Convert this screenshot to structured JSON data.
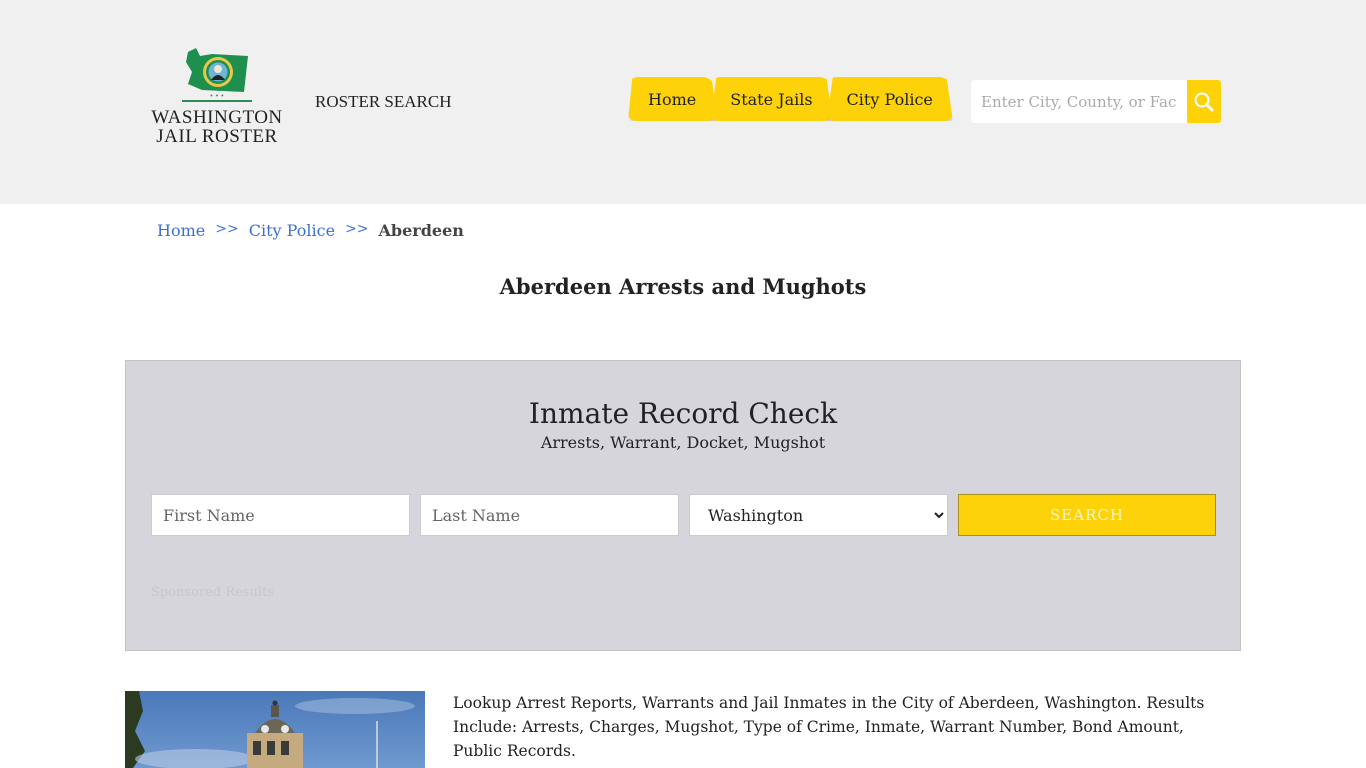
{
  "header": {
    "logo": {
      "line1": "WASHINGTON",
      "line2": "JAIL ROSTER"
    },
    "roster_search": "ROSTER SEARCH",
    "nav": [
      {
        "label": "Home"
      },
      {
        "label": "State Jails"
      },
      {
        "label": "City Police"
      }
    ],
    "search": {
      "placeholder": "Enter City, County, or Facility",
      "icon": "search-icon"
    }
  },
  "breadcrumb": {
    "items": [
      {
        "label": "Home"
      },
      {
        "label": "City Police"
      }
    ],
    "separator": ">>",
    "current": "Aberdeen"
  },
  "page": {
    "title": "Aberdeen Arrests and Mughots"
  },
  "record_check": {
    "title": "Inmate Record Check",
    "subtitle": "Arrests, Warrant, Docket, Mugshot",
    "first_name_placeholder": "First Name",
    "last_name_placeholder": "Last Name",
    "state_selected": "Washington",
    "search_label": "SEARCH",
    "sponsored": "Sponsored Results"
  },
  "content": {
    "description": "Lookup Arrest Reports, Warrants and Jail Inmates in the City of Aberdeen, Washington. Results Include: Arrests, Charges, Mugshot, Type of Crime, Inmate, Warrant Number, Bond Amount, Public Records."
  },
  "colors": {
    "accent": "#fed208",
    "link": "#3a6fd8",
    "panel": "#d6d5db",
    "header_bg": "#f0f0f0"
  }
}
